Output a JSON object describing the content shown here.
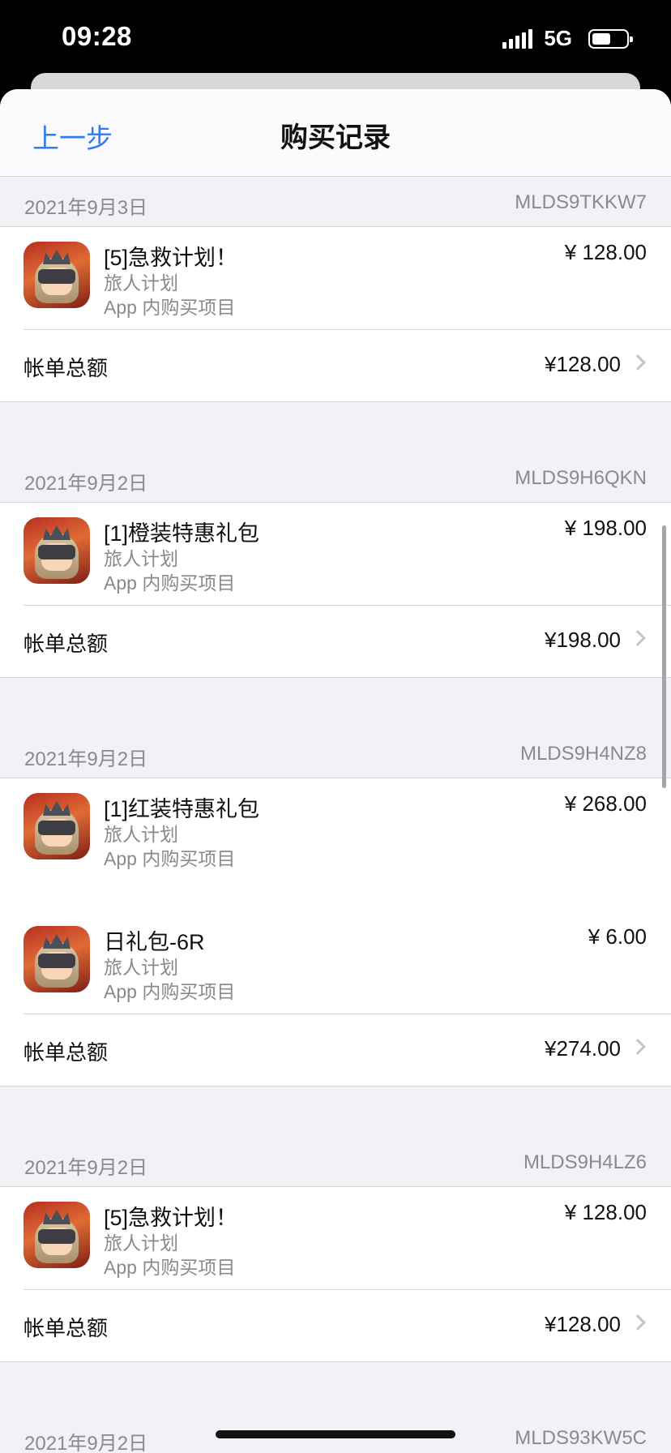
{
  "status_bar": {
    "time": "09:28",
    "network": "5G",
    "battery_level_pct": 55,
    "icons": [
      "signal-icon",
      "battery-icon"
    ]
  },
  "nav": {
    "back_label": "上一步",
    "title": "购买记录"
  },
  "colors": {
    "accent": "#2f7cf6",
    "background": "#f2f2f6",
    "secondary_text": "#8a8a8e"
  },
  "sections": [
    {
      "date": "2021年9月3日",
      "order_id": "MLDS9TKKW7",
      "items": [
        {
          "name": "[5]急救计划！",
          "app": "旅人计划",
          "type": "App 内购买项目",
          "price": "¥ 128.00"
        }
      ],
      "total_label": "帐单总额",
      "total": "¥128.00"
    },
    {
      "date": "2021年9月2日",
      "order_id": "MLDS9H6QKN",
      "items": [
        {
          "name": "[1]橙装特惠礼包",
          "app": "旅人计划",
          "type": "App 内购买项目",
          "price": "¥ 198.00"
        }
      ],
      "total_label": "帐单总额",
      "total": "¥198.00"
    },
    {
      "date": "2021年9月2日",
      "order_id": "MLDS9H4NZ8",
      "items": [
        {
          "name": "[1]红装特惠礼包",
          "app": "旅人计划",
          "type": "App 内购买项目",
          "price": "¥ 268.00"
        },
        {
          "name": "日礼包-6R",
          "app": "旅人计划",
          "type": "App 内购买项目",
          "price": "¥ 6.00"
        }
      ],
      "total_label": "帐单总额",
      "total": "¥274.00"
    },
    {
      "date": "2021年9月2日",
      "order_id": "MLDS9H4LZ6",
      "items": [
        {
          "name": "[5]急救计划！",
          "app": "旅人计划",
          "type": "App 内购买项目",
          "price": "¥ 128.00"
        }
      ],
      "total_label": "帐单总额",
      "total": "¥128.00"
    },
    {
      "date": "2021年9月2日",
      "order_id": "MLDS93KW5C"
    }
  ]
}
